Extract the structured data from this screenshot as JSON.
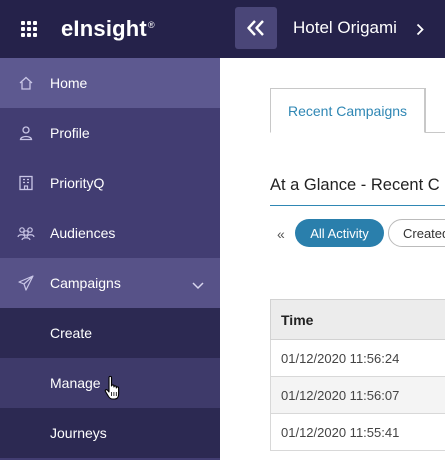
{
  "brand": {
    "logo": "eInsight",
    "trademark": "®"
  },
  "sidebar": {
    "items": [
      {
        "label": "Home",
        "icon": "home-icon"
      },
      {
        "label": "Profile",
        "icon": "person-icon"
      },
      {
        "label": "PriorityQ",
        "icon": "building-icon"
      },
      {
        "label": "Audiences",
        "icon": "people-icon"
      },
      {
        "label": "Campaigns",
        "icon": "paper-plane-icon"
      }
    ],
    "campaign_subitems": [
      {
        "label": "Create"
      },
      {
        "label": "Manage"
      },
      {
        "label": "Journeys"
      }
    ]
  },
  "topbar": {
    "hotel_name": "Hotel Origami"
  },
  "main": {
    "tabs": [
      {
        "label": "Recent Campaigns"
      }
    ],
    "glance_title": "At a Glance - Recent C",
    "filter_prev": "«",
    "filters": [
      {
        "label": "All Activity"
      },
      {
        "label": "Created"
      }
    ],
    "table": {
      "header": "Time",
      "rows": [
        "01/12/2020 11:56:24",
        "01/12/2020 11:56:07",
        "01/12/2020 11:55:41"
      ]
    }
  },
  "colors": {
    "sidebar_bg": "#423d72",
    "topbar_bg": "#25224a",
    "accent": "#2a7fac"
  }
}
